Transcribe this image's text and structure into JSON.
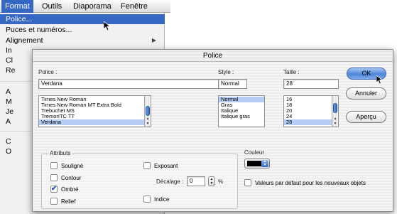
{
  "menubar": {
    "items": [
      {
        "label": "Format",
        "active": true
      },
      {
        "label": "Outils",
        "active": false
      },
      {
        "label": "Diaporama",
        "active": false
      },
      {
        "label": "Fenêtre",
        "active": false
      }
    ]
  },
  "menu": {
    "items": [
      {
        "label": "Police...",
        "active": true
      },
      {
        "label": "Puces et numéros...",
        "active": false
      },
      {
        "label": "Alignement",
        "submenu": true
      },
      {
        "label": "In",
        "active": false
      },
      {
        "label": "Cl",
        "active": false
      },
      {
        "label": "Re",
        "active": false
      },
      {
        "label": "A",
        "active": false
      },
      {
        "label": "M",
        "active": false
      },
      {
        "label": "Je",
        "active": false
      },
      {
        "label": "A",
        "active": false
      },
      {
        "label": "C",
        "active": false
      },
      {
        "label": "O",
        "active": false
      }
    ]
  },
  "dialog": {
    "title": "Police",
    "font": {
      "label": "Police :",
      "value": "Verdana",
      "options": [
        "Times New Roman",
        "Times New Roman MT Extra Bold",
        "Trebuchet MS",
        "TremorITC TT",
        "Verdana"
      ],
      "selected": "Verdana"
    },
    "style": {
      "label": "Style :",
      "value": "Normal",
      "options": [
        "Normal",
        "Gras",
        "Italique",
        "Italique gras"
      ],
      "selected": "Normal"
    },
    "size": {
      "label": "Taille :",
      "value": "28",
      "options": [
        "16",
        "18",
        "20",
        "24",
        "28"
      ],
      "selected": "28"
    },
    "buttons": {
      "ok": "OK",
      "cancel": "Annuler",
      "preview": "Aperçu"
    },
    "attributes": {
      "label": "Attributs",
      "underline": {
        "label": "Souligné",
        "checked": false
      },
      "outline": {
        "label": "Contour",
        "checked": false
      },
      "shadow": {
        "label": "Ombré",
        "checked": true
      },
      "emboss": {
        "label": "Relief",
        "checked": false
      },
      "superscript": {
        "label": "Exposant",
        "checked": false
      },
      "subscript": {
        "label": "Indice",
        "checked": false
      },
      "offset": {
        "label": "Décalage :",
        "value": "0",
        "unit": "%"
      }
    },
    "color": {
      "label": "Couleur",
      "value": "#000000",
      "default_label": "Valeurs par défaut pour les nouveaux objets",
      "default_checked": false
    }
  },
  "colors": {
    "menu_highlight": "#3568c2",
    "list_selection": "#b5cdf2",
    "ok_button": "#4f86d9"
  }
}
